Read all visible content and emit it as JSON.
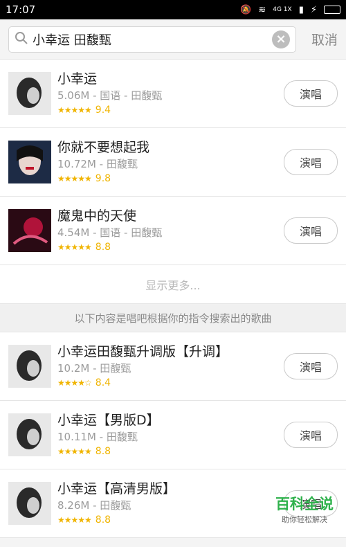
{
  "status": {
    "time": "17:07",
    "net": "4G 1X"
  },
  "search": {
    "query": "小幸运 田馥甄",
    "cancel": "取消"
  },
  "results": [
    {
      "title": "小幸运",
      "meta": "5.06M - 国语 - 田馥甄",
      "stars": "★★★★★",
      "rating": "9.4",
      "btn": "演唱"
    },
    {
      "title": "你就不要想起我",
      "meta": "10.72M - 田馥甄",
      "stars": "★★★★★",
      "rating": "9.8",
      "btn": "演唱"
    },
    {
      "title": "魔鬼中的天使",
      "meta": "4.54M - 国语 - 田馥甄",
      "stars": "★★★★★",
      "rating": "8.8",
      "btn": "演唱"
    }
  ],
  "more_label": "显示更多...",
  "section_label": "以下内容是唱吧根据你的指令搜索出的歌曲",
  "related": [
    {
      "title": "小幸运田馥甄升调版【升调】",
      "meta": "10.2M - 田馥甄",
      "stars": "★★★★☆",
      "rating": "8.4",
      "btn": "演唱"
    },
    {
      "title": "小幸运【男版D】",
      "meta": "10.11M - 田馥甄",
      "stars": "★★★★★",
      "rating": "8.8",
      "btn": "演唱"
    },
    {
      "title": "小幸运【高清男版】",
      "meta": "8.26M - 田馥甄",
      "stars": "★★★★★",
      "rating": "8.8",
      "btn": "演唱"
    }
  ],
  "watermark": {
    "big": "百科全说",
    "small": "助你轻松解决"
  }
}
